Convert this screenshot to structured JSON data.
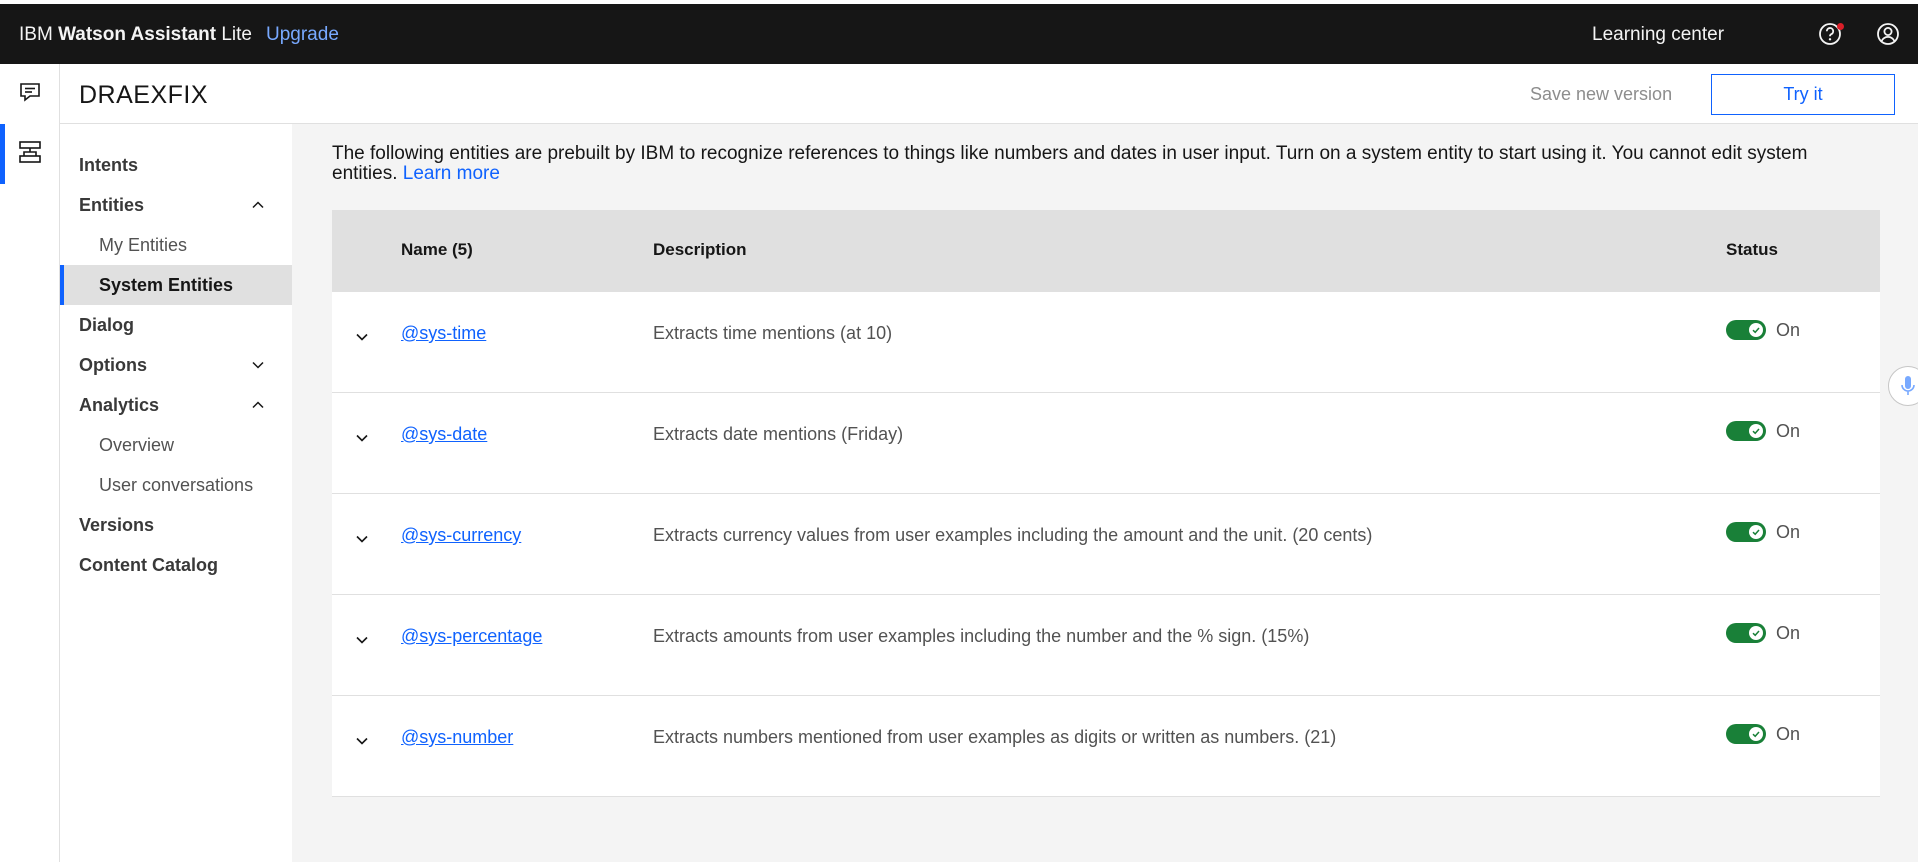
{
  "topbar": {
    "brand_prefix": "IBM",
    "brand_bold": "Watson Assistant",
    "brand_suffix": "Lite",
    "upgrade": "Upgrade",
    "learning_center": "Learning center"
  },
  "header": {
    "skill_title": "DRAEXFIX",
    "save_version": "Save new version",
    "try_it": "Try it"
  },
  "sidenav": {
    "items": [
      {
        "label": "Intents"
      },
      {
        "label": "Entities",
        "chevron": "up"
      },
      {
        "label": "My Entities"
      },
      {
        "label": "System Entities",
        "active": true
      },
      {
        "label": "Dialog"
      },
      {
        "label": "Options",
        "chevron": "down"
      },
      {
        "label": "Analytics",
        "chevron": "up"
      },
      {
        "label": "Overview"
      },
      {
        "label": "User conversations"
      },
      {
        "label": "Versions"
      },
      {
        "label": "Content Catalog"
      }
    ]
  },
  "main": {
    "intro": "The following entities are prebuilt by IBM to recognize references to things like numbers and dates in user input. Turn on a system entity to start using it. You cannot edit system entities.",
    "learn_more": "Learn more",
    "columns": {
      "name": "Name (5)",
      "description": "Description",
      "status": "Status"
    },
    "rows": [
      {
        "name": "@sys-time",
        "description": "Extracts time mentions (at 10)",
        "status": "On"
      },
      {
        "name": "@sys-date",
        "description": "Extracts date mentions (Friday)",
        "status": "On"
      },
      {
        "name": "@sys-currency",
        "description": "Extracts currency values from user examples including the amount and the unit. (20 cents)",
        "status": "On"
      },
      {
        "name": "@sys-percentage",
        "description": "Extracts amounts from user examples including the number and the % sign. (15%)",
        "status": "On"
      },
      {
        "name": "@sys-number",
        "description": "Extracts numbers mentioned from user examples as digits or written as numbers. (21)",
        "status": "On"
      }
    ]
  },
  "colors": {
    "topbar_bg": "#161616",
    "link": "#0f62fe",
    "toggle_on": "#198038",
    "active_indicator": "#0f62fe"
  },
  "icons": [
    "help-icon",
    "user-avatar-icon",
    "chat-icon",
    "skill-icon",
    "chevron-up-icon",
    "chevron-down-icon",
    "checkmark-icon",
    "microphone-icon"
  ]
}
